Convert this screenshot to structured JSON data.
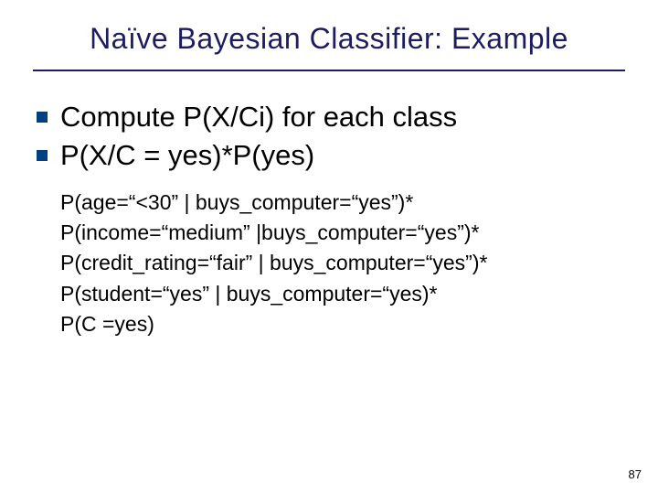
{
  "title": "Naïve Bayesian Classifier:  Example",
  "bullets": [
    "Compute P(X/Ci) for each class",
    "P(X/C = yes)*P(yes)"
  ],
  "details": [
    "P(age=“<30” | buys_computer=“yes”)*",
    "P(income=“medium” |buys_computer=“yes”)*",
    "P(credit_rating=“fair” | buys_computer=“yes”)*",
    "P(student=“yes” | buys_computer=“yes)*",
    "P(C =yes)"
  ],
  "page_number": "87"
}
